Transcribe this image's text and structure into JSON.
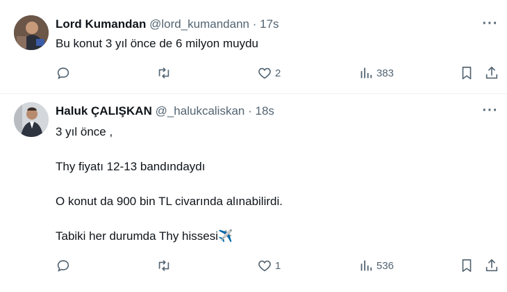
{
  "tweets": [
    {
      "name": "Lord Kumandan",
      "handle": "@lord_kumandann",
      "dot": "·",
      "time": "17s",
      "more": "···",
      "text": [
        "Bu konut 3 yıl önce de 6 milyon muydu"
      ],
      "likes": "2",
      "views": "383"
    },
    {
      "name": "Haluk ÇALIŞKAN",
      "handle": "@_halukcaliskan",
      "dot": "·",
      "time": "18s",
      "more": "···",
      "text": [
        "3 yıl önce ,",
        "Thy fiyatı 12-13 bandındaydı",
        "O konut da 900 bin TL civarında alınabilirdi.",
        "Tabiki her durumda Thy hissesi✈️"
      ],
      "likes": "1",
      "views": "536"
    }
  ],
  "icons": {
    "reply": "reply-icon",
    "retweet": "retweet-icon",
    "like": "heart-icon",
    "views": "views-icon",
    "bookmark": "bookmark-icon",
    "share": "share-icon",
    "more": "more-icon"
  },
  "colors": {
    "text": "#0f1419",
    "secondary": "#536471",
    "divider": "#eff3f4"
  }
}
